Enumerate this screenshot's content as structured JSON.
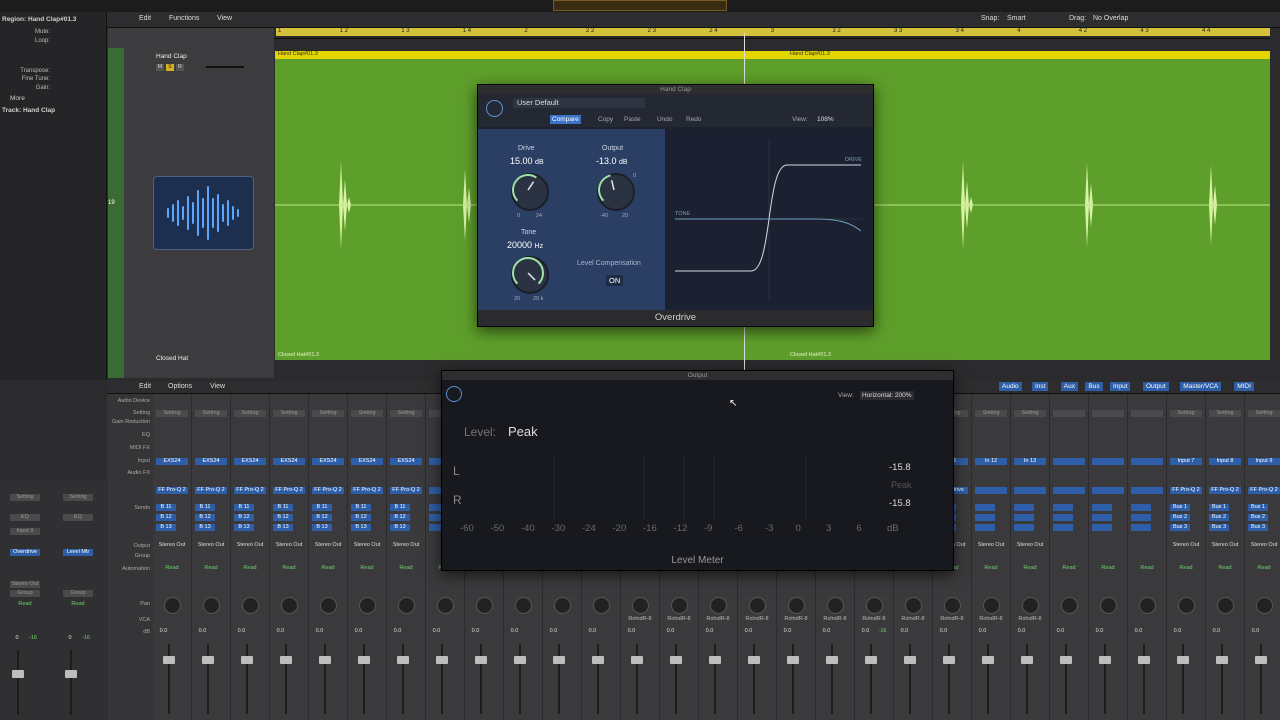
{
  "inspector": {
    "region_label": "Region: Hand Clap#01.3",
    "rows": [
      "Mute:",
      "Loop:",
      "Transpose:",
      "Fine Tune:",
      "Gain:"
    ],
    "more": "More",
    "track_label": "Track: Hand Clap",
    "channel_left": {
      "setting": "Setting",
      "eq": "EQ",
      "input": "Input 9",
      "plugin": "Overdrive",
      "sends": "Sends",
      "output": "Stereo Out",
      "group": "Group",
      "automation": "Read",
      "pan_value": "0",
      "db_value": "-16"
    },
    "channel_right": {
      "setting": "Setting",
      "eq": "EQ",
      "plugin": "Level Mtr",
      "group": "Group",
      "automation": "Read",
      "pan_value": "0",
      "db_value": "-16"
    }
  },
  "track_toolbar": {
    "edit": "Edit",
    "functions": "Functions",
    "view": "View",
    "snap_label": "Snap:",
    "snap_value": "Smart",
    "drag_label": "Drag:",
    "drag_value": "No Overlap"
  },
  "ruler": {
    "ticks": [
      "1",
      "1 2",
      "1 3",
      "1 4",
      "2",
      "2 2",
      "2 3",
      "2 4",
      "3",
      "3 2",
      "3 3",
      "3 4",
      "4",
      "4 2",
      "4 3",
      "4 4"
    ]
  },
  "tracks": {
    "track1": {
      "name": "Hand Clap",
      "region": "Hand Clap#01.3",
      "number": "19"
    },
    "track2": {
      "name": "Closed Hat",
      "region": "Closed Hat#01.3"
    }
  },
  "overdrive": {
    "window_title": "Hand Clap",
    "preset": "User Default",
    "compare": "Compare",
    "copy": "Copy",
    "paste": "Paste",
    "undo": "Undo",
    "redo": "Redo",
    "view_label": "View:",
    "view_value": "108%",
    "drive_label": "Drive",
    "drive_value": "15.00",
    "drive_unit": "dB",
    "drive_min": "0",
    "drive_max": "24",
    "output_label": "Output",
    "output_value": "-13.0",
    "output_unit": "dB",
    "output_min": "-40",
    "output_max": "20",
    "output_zero": "0",
    "tone_label": "Tone",
    "tone_value": "20000",
    "tone_unit": "Hz",
    "tone_min": "20",
    "tone_max": "20 k",
    "level_comp_label": "Level Compensation",
    "level_comp_value": "ON",
    "graph_drive": "DRIVE",
    "graph_tone": "TONE",
    "plugin_name": "Overdrive",
    "knob_levels": {
      "drive": 0.625,
      "output": 0.45,
      "tone": 1.0
    }
  },
  "levelmeter": {
    "window_title": "Output",
    "view_label": "View:",
    "view_value": "Horizontal: 200%",
    "level_label": "Level:",
    "level_value": "Peak",
    "channel_l": "L",
    "channel_r": "R",
    "value_l": "-15.8",
    "value_peak": "Peak",
    "value_r": "-15.8",
    "scale": [
      "-60",
      "-50",
      "-40",
      "-30",
      "-24",
      "-20",
      "-16",
      "-12",
      "-9",
      "-6",
      "-3",
      "0",
      "3",
      "6",
      "dB"
    ],
    "plugin_name": "Level Meter"
  },
  "mixer_toolbar": {
    "edit": "Edit",
    "options": "Options",
    "view": "View",
    "filters": [
      "Audio",
      "Inst",
      "Aux",
      "Bus",
      "Input",
      "Output",
      "Master/VCA",
      "MIDI"
    ]
  },
  "mixer_labels": [
    "Audio Device",
    "Setting",
    "Gain Reduction",
    "EQ",
    "MIDI FX",
    "Input",
    "Audio FX",
    "Sends",
    "Output",
    "Group",
    "Automation",
    "Pan",
    "VCA",
    "dB"
  ],
  "strips": [
    {
      "setting": "Setting",
      "input": "EXS24",
      "fx": "FF Pro-Q 2",
      "sends": [
        "B 11",
        "B 12",
        "B 13"
      ],
      "output": "Stereo Out",
      "auto": "Read",
      "db": "0.0"
    },
    {
      "setting": "Setting",
      "input": "EXS24",
      "fx": "FF Pro-Q 2",
      "sends": [
        "B 11",
        "B 12",
        "B 13"
      ],
      "output": "Stereo Out",
      "auto": "Read",
      "db": "0.0"
    },
    {
      "setting": "Setting",
      "input": "EXS24",
      "fx": "FF Pro-Q 2",
      "sends": [
        "B 11",
        "B 12",
        "B 13"
      ],
      "output": "Stereo Out",
      "auto": "Read",
      "db": "0.0"
    },
    {
      "setting": "Setting",
      "input": "EXS24",
      "fx": "FF Pro-Q 2",
      "sends": [
        "B 11",
        "B 12",
        "B 13"
      ],
      "output": "Stereo Out",
      "auto": "Read",
      "db": "0.0"
    },
    {
      "setting": "Setting",
      "input": "EXS24",
      "fx": "FF Pro-Q 2",
      "sends": [
        "B 11",
        "B 12",
        "B 13"
      ],
      "output": "Stereo Out",
      "auto": "Read",
      "db": "0.0"
    },
    {
      "setting": "Setting",
      "input": "EXS24",
      "fx": "FF Pro-Q 2",
      "sends": [
        "B 11",
        "B 12",
        "B 13"
      ],
      "output": "Stereo Out",
      "auto": "Read",
      "db": "0.0"
    },
    {
      "setting": "Setting",
      "input": "EXS24",
      "fx": "FF Pro-Q 2",
      "sends": [
        "B 11",
        "B 12",
        "B 13"
      ],
      "output": "Stereo Out",
      "auto": "Read",
      "db": "0.0"
    },
    {
      "setting": "",
      "input": "",
      "fx": "",
      "sends": [
        "",
        "",
        ""
      ],
      "output": "",
      "auto": "Read",
      "db": "0.0"
    },
    {
      "setting": "",
      "input": "",
      "fx": "",
      "sends": [
        "",
        "",
        ""
      ],
      "output": "",
      "auto": "Read",
      "db": "0.0"
    },
    {
      "setting": "",
      "input": "",
      "fx": "",
      "sends": [
        "",
        "",
        ""
      ],
      "output": "",
      "auto": "Read",
      "db": "0.0"
    },
    {
      "setting": "",
      "input": "",
      "fx": "",
      "sends": [
        "",
        "",
        ""
      ],
      "output": "",
      "auto": "Read",
      "db": "0.0"
    },
    {
      "setting": "",
      "input": "",
      "fx": "",
      "sends": [
        "",
        "",
        ""
      ],
      "output": "",
      "auto": "Read",
      "db": "0.0"
    },
    {
      "setting": "",
      "input": "",
      "fx": "",
      "sends": [
        "",
        "",
        ""
      ],
      "output": "",
      "auto": "Read",
      "db": "0.0",
      "vca": "RolndR-8"
    },
    {
      "setting": "",
      "input": "",
      "fx": "",
      "sends": [
        "",
        "",
        ""
      ],
      "output": "",
      "auto": "Read",
      "db": "0.0",
      "vca": "RolndR-8"
    },
    {
      "setting": "",
      "input": "",
      "fx": "",
      "sends": [
        "",
        "",
        ""
      ],
      "output": "",
      "auto": "Read",
      "db": "0.0",
      "vca": "RolndR-8"
    },
    {
      "setting": "",
      "input": "",
      "fx": "",
      "sends": [
        "",
        "",
        ""
      ],
      "output": "",
      "auto": "Read",
      "db": "0.0",
      "vca": "RolndR-8"
    },
    {
      "setting": "",
      "input": "",
      "fx": "",
      "sends": [
        "",
        "",
        ""
      ],
      "output": "",
      "auto": "Read",
      "db": "0.0",
      "vca": "RolndR-8"
    },
    {
      "setting": "",
      "input": "",
      "fx": "",
      "sends": [
        "",
        "",
        ""
      ],
      "output": "",
      "auto": "Read",
      "db": "0.0",
      "vca": "RolndR-8"
    },
    {
      "setting": "",
      "input": "",
      "fx": "",
      "sends": [
        "",
        "",
        ""
      ],
      "output": "",
      "auto": "Read",
      "db": "0.0",
      "vca": "RolndR-8",
      "db2": "-16"
    },
    {
      "setting": "",
      "input": "",
      "fx": "",
      "sends": [
        "",
        "",
        ""
      ],
      "output": "",
      "auto": "Read",
      "db": "0.0",
      "vca": "RolndR-8"
    },
    {
      "setting": "Setting",
      "input": "I 11",
      "fx": "Overdrive",
      "sends": [
        "",
        "",
        ""
      ],
      "output": "Stereo Out",
      "auto": "Read",
      "db": "0.0",
      "vca": "RolndR-8"
    },
    {
      "setting": "Setting",
      "input": "In 12",
      "fx": "",
      "sends": [
        "",
        "",
        ""
      ],
      "output": "Stereo Out",
      "auto": "Read",
      "db": "0.0",
      "vca": "RolndR-8"
    },
    {
      "setting": "Setting",
      "input": "In 13",
      "fx": "",
      "sends": [
        "",
        "",
        ""
      ],
      "output": "Stereo Out",
      "auto": "Read",
      "db": "0.0",
      "vca": "RolndR-8"
    },
    {
      "setting": "",
      "input": "",
      "fx": "",
      "sends": [
        "",
        "",
        ""
      ],
      "output": "",
      "auto": "Read",
      "db": "0.0"
    },
    {
      "setting": "",
      "input": "",
      "fx": "",
      "sends": [
        "",
        "",
        ""
      ],
      "output": "",
      "auto": "Read",
      "db": "0.0"
    },
    {
      "setting": "",
      "input": "",
      "fx": "",
      "sends": [
        "",
        "",
        ""
      ],
      "output": "",
      "auto": "Read",
      "db": "0.0"
    },
    {
      "setting": "Setting",
      "input": "Input 7",
      "fx": "FF Pro-Q 2",
      "sends": [
        "Bus 1",
        "Bus 2",
        "Bus 3"
      ],
      "output": "Stereo Out",
      "auto": "Read",
      "db": "0.0"
    },
    {
      "setting": "Setting",
      "input": "Input 8",
      "fx": "FF Pro-Q 2",
      "sends": [
        "Bus 1",
        "Bus 2",
        "Bus 3"
      ],
      "output": "Stereo Out",
      "auto": "Read",
      "db": "0.0"
    },
    {
      "setting": "Setting",
      "input": "Input 9",
      "fx": "FF Pro-Q 2",
      "sends": [
        "Bus 1",
        "Bus 2",
        "Bus 3"
      ],
      "output": "Stereo Out",
      "auto": "Read",
      "db": "0.0"
    }
  ]
}
